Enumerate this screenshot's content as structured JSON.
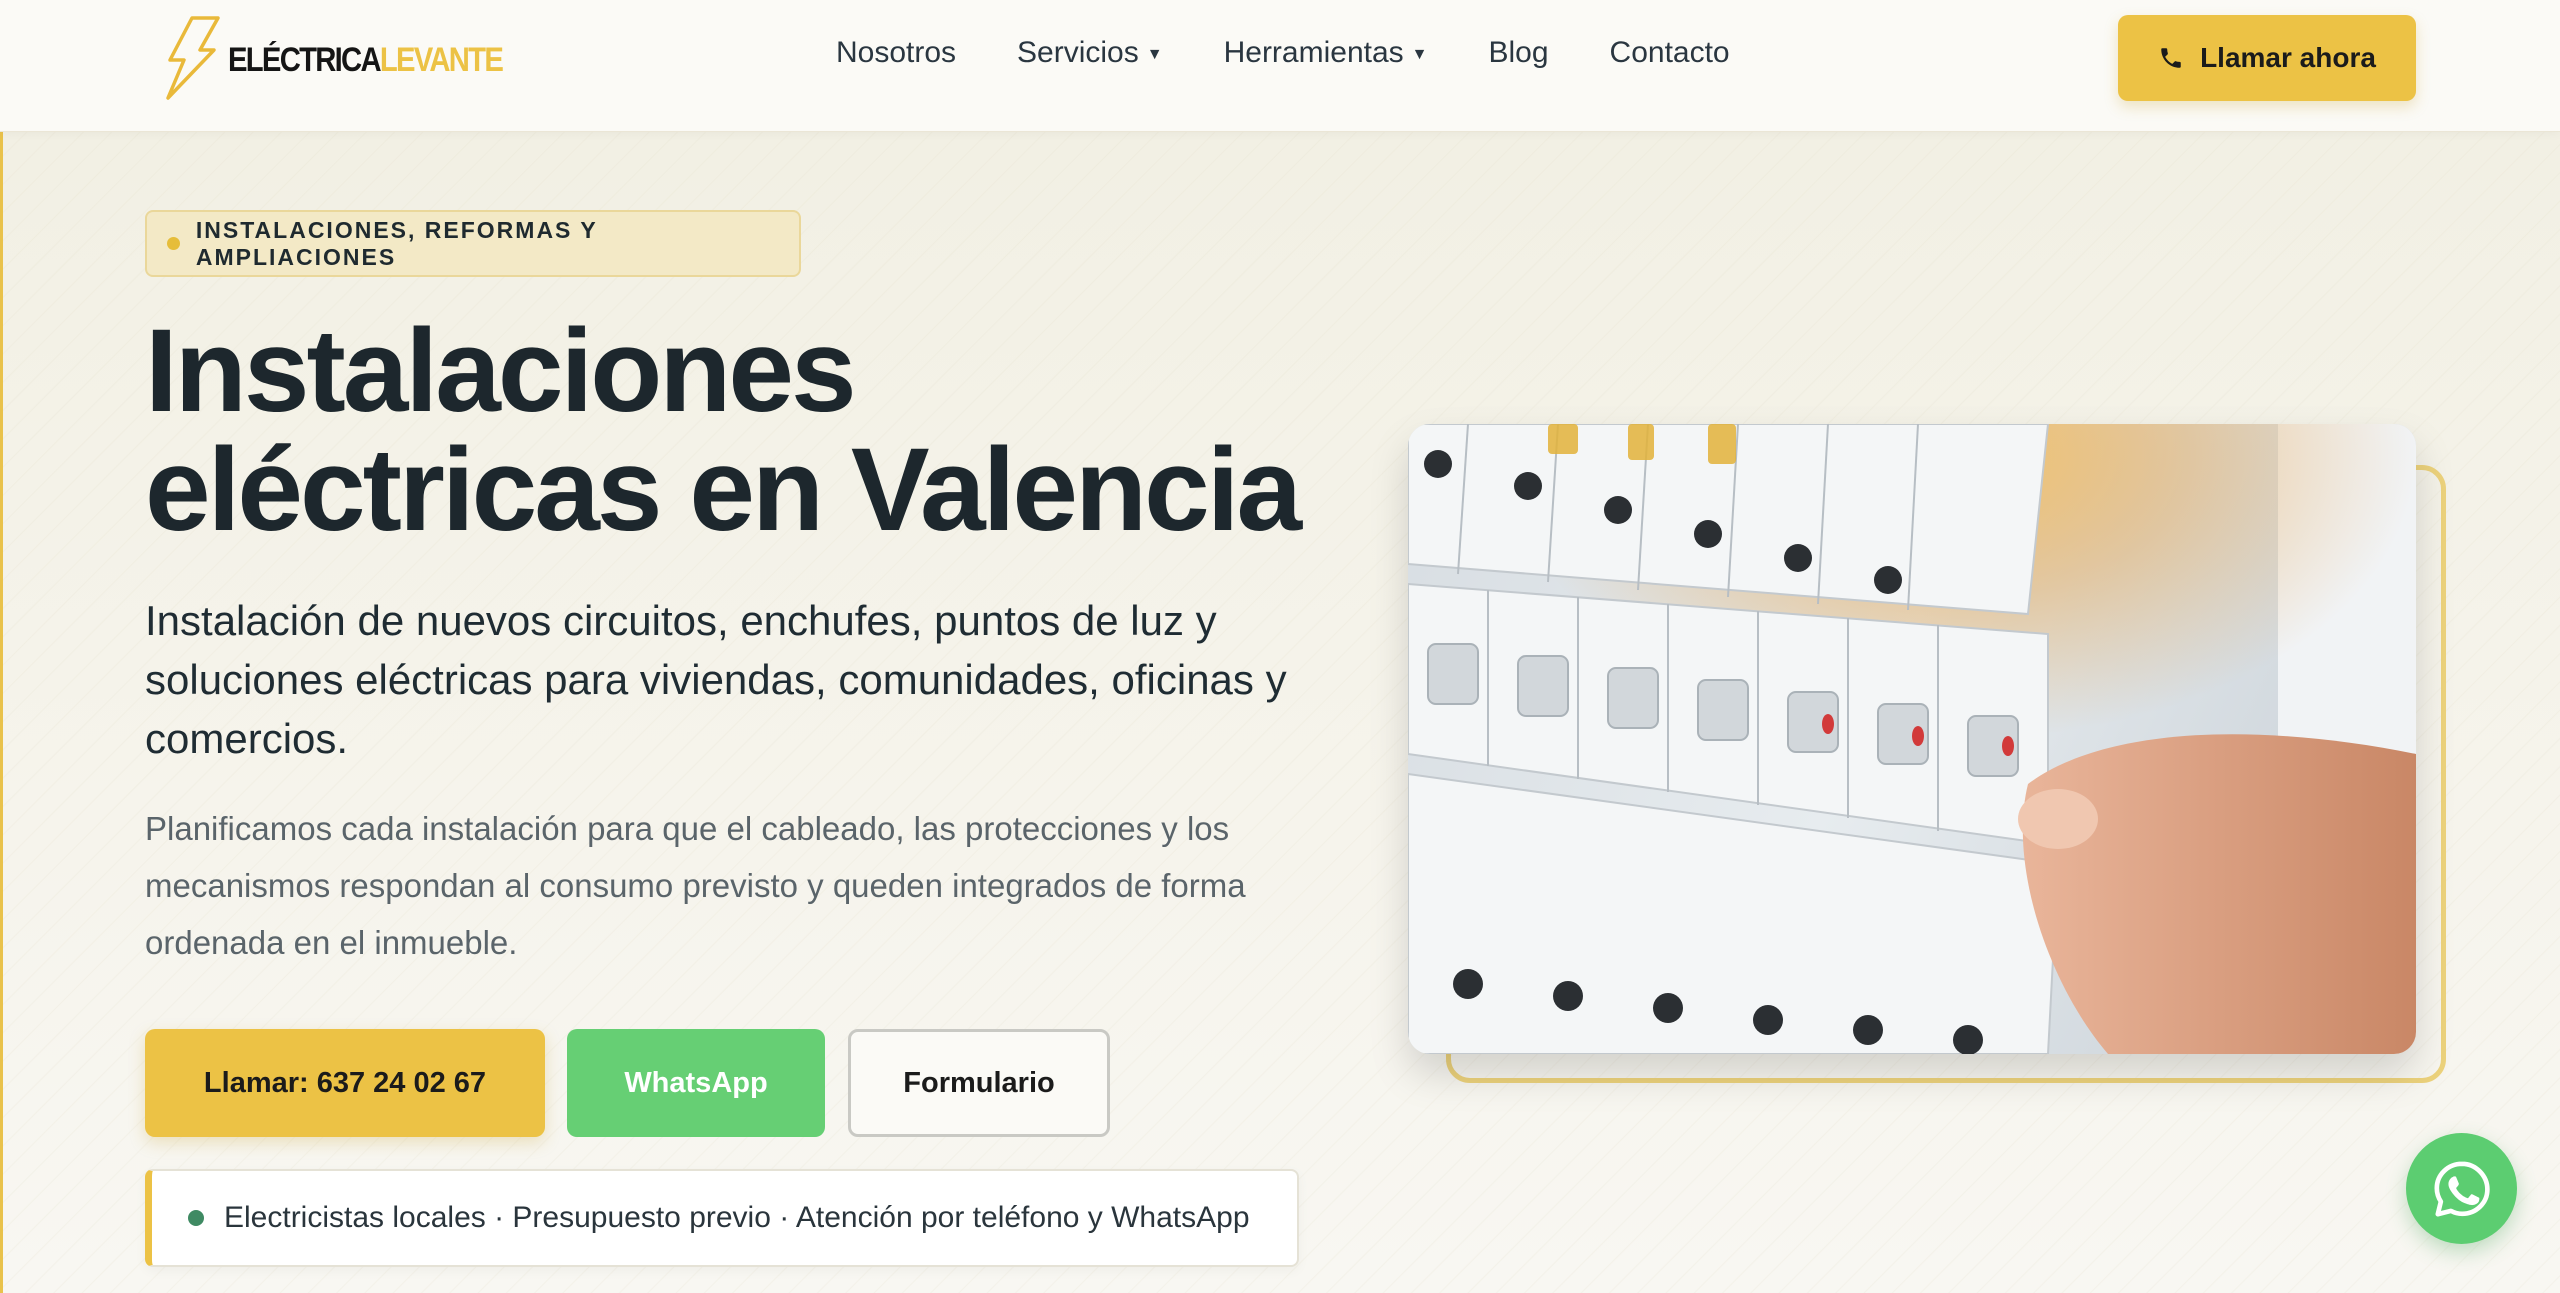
{
  "header": {
    "logo": {
      "part1": "ELÉCTRICA",
      "part2": "LEVANTE"
    },
    "nav": [
      {
        "label": "Nosotros",
        "dropdown": false
      },
      {
        "label": "Servicios",
        "dropdown": true
      },
      {
        "label": "Herramientas",
        "dropdown": true
      },
      {
        "label": "Blog",
        "dropdown": false
      },
      {
        "label": "Contacto",
        "dropdown": false
      }
    ],
    "call_button": {
      "label": "Llamar ahora",
      "icon": "phone-icon"
    }
  },
  "hero": {
    "eyebrow": "INSTALACIONES, REFORMAS Y AMPLIACIONES",
    "title_line1": "Instalaciones",
    "title_line2": "eléctricas en Valencia",
    "subtitle": "Instalación de nuevos circuitos, enchufes, puntos de luz y soluciones eléctricas para viviendas, comunidades, oficinas y comercios.",
    "body": "Planificamos cada instalación para que el cableado, las protecciones y los mecanismos respondan al consumo previsto y queden integrados de forma ordenada en el inmueble.",
    "buttons": {
      "call": "Llamar: 637 24 02 67",
      "whatsapp": "WhatsApp",
      "form": "Formulario"
    },
    "trust": "Electricistas locales · Presupuesto previo · Atención por teléfono y WhatsApp"
  },
  "colors": {
    "accent": "#ecc245",
    "whatsapp": "#66cf74",
    "text_dark": "#1d272d",
    "trust_dot": "#3f8a63"
  },
  "floating": {
    "icon": "whatsapp-icon"
  }
}
